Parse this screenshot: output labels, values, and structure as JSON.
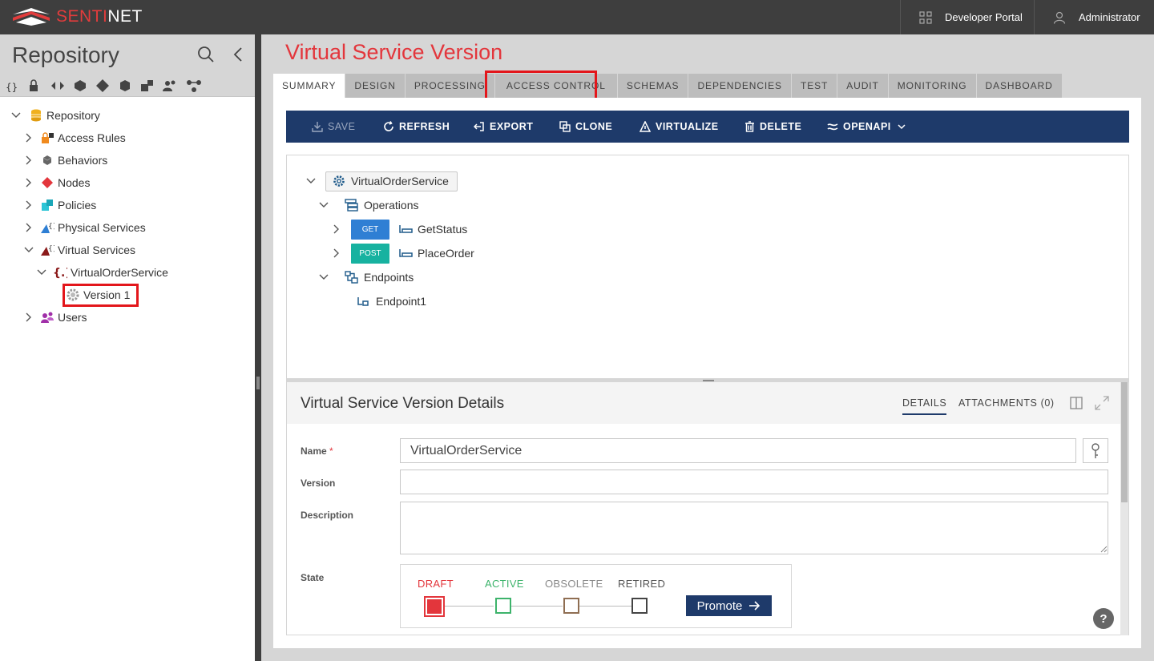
{
  "app": {
    "logo_prefix": "SENTI",
    "logo_suffix": "NET",
    "developer_portal": "Developer Portal",
    "user": "Administrator"
  },
  "sidebar": {
    "title": "Repository",
    "tree": {
      "root": "Repository",
      "items": [
        {
          "label": "Access Rules",
          "icon": "lock-icon"
        },
        {
          "label": "Behaviors",
          "icon": "behaviors-icon"
        },
        {
          "label": "Nodes",
          "icon": "nodes-icon"
        },
        {
          "label": "Policies",
          "icon": "policies-icon"
        },
        {
          "label": "Physical Services",
          "icon": "physical-services-icon"
        },
        {
          "label": "Virtual Services",
          "icon": "virtual-services-icon"
        }
      ],
      "virtual_service": "VirtualOrderService",
      "version": "Version 1",
      "users": "Users"
    }
  },
  "main": {
    "title": "Virtual Service Version",
    "tabs": [
      "SUMMARY",
      "DESIGN",
      "PROCESSING",
      "ACCESS CONTROL",
      "SCHEMAS",
      "DEPENDENCIES",
      "TEST",
      "AUDIT",
      "MONITORING",
      "DASHBOARD"
    ],
    "toolbar": {
      "save": "SAVE",
      "refresh": "REFRESH",
      "export": "EXPORT",
      "clone": "CLONE",
      "virtualize": "VIRTUALIZE",
      "delete": "DELETE",
      "openapi": "OPENAPI"
    },
    "service_tree": {
      "root": "VirtualOrderService",
      "operations": "Operations",
      "ops": [
        {
          "verb": "GET",
          "name": "GetStatus",
          "color": "#2f7fd4"
        },
        {
          "verb": "POST",
          "name": "PlaceOrder",
          "color": "#17b2a0"
        }
      ],
      "endpoints": "Endpoints",
      "endpoint": "Endpoint1"
    },
    "details": {
      "title": "Virtual Service Version Details",
      "tab_details": "DETAILS",
      "tab_attachments": "ATTACHMENTS (0)",
      "name_label": "Name",
      "name_required": "*",
      "name_value": "VirtualOrderService",
      "version_label": "Version",
      "version_value": "",
      "description_label": "Description",
      "description_value": "",
      "state_label": "State",
      "states": [
        {
          "label": "DRAFT",
          "color": "#e3363c"
        },
        {
          "label": "ACTIVE",
          "color": "#3db36b"
        },
        {
          "label": "OBSOLETE",
          "color": "#8f6e52"
        },
        {
          "label": "RETIRED",
          "color": "#444444"
        }
      ],
      "promote": "Promote"
    }
  },
  "help": "?"
}
